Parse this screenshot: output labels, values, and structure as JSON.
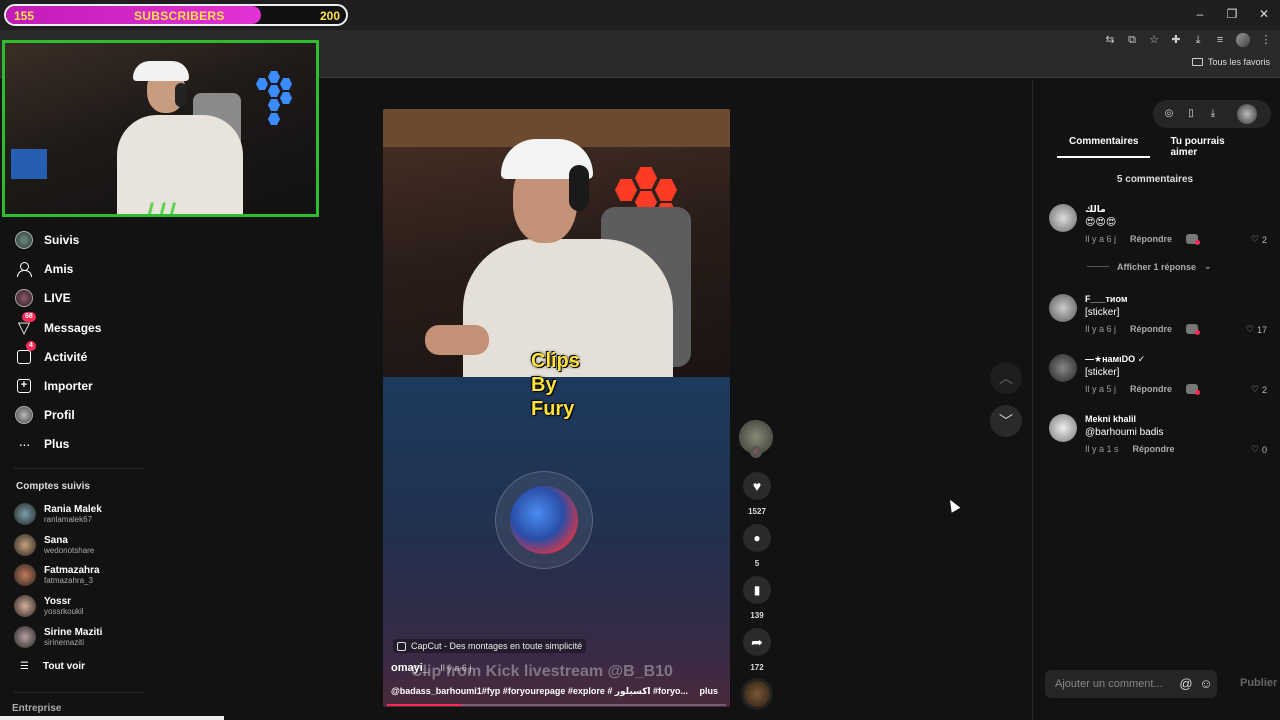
{
  "subscriber_bar": {
    "min": "155",
    "title": "SUBSCRIBERS",
    "max": "200",
    "progress_fraction": 0.75
  },
  "window": {
    "minimize": "–",
    "restore": "❐",
    "close": "✕"
  },
  "bookmarks": {
    "folder_label": "Tous les favoris"
  },
  "sidebar": {
    "nav": [
      {
        "label": "Suivis"
      },
      {
        "label": "Amis"
      },
      {
        "label": "LIVE"
      },
      {
        "label": "Messages",
        "badge": "68"
      },
      {
        "label": "Activité",
        "badge": "4"
      },
      {
        "label": "Importer"
      },
      {
        "label": "Profil"
      },
      {
        "label": "Plus"
      }
    ],
    "following_title": "Comptes suivis",
    "following": [
      {
        "name": "Rania Malek",
        "handle": "ranlamalek67",
        "color": "#7aa0a8"
      },
      {
        "name": "Sana",
        "handle": "wedonotshare",
        "color": "#c9a27a"
      },
      {
        "name": "Fatmazahra",
        "handle": "fatmazahra_3",
        "color": "#c47a5a"
      },
      {
        "name": "Yossr",
        "handle": "yossrkoukil",
        "color": "#d9b09a"
      },
      {
        "name": "Sirine Maziti",
        "handle": "sirinemaziti",
        "color": "#b8a0a0"
      }
    ],
    "see_all": "Tout voir",
    "footer": "Entreprise"
  },
  "video": {
    "caption_lines": [
      "Clips",
      "By",
      "Fury"
    ],
    "capcut": "CapCut - Des montages en toute simplicité",
    "watermark": "Clip from Kick livestream @B_B10",
    "author": "omayi_",
    "time": "· Il y a 6 j",
    "description": "@badass_barhoumi1#fyp #foryourepage #explore # اكسبلور #foryo...",
    "more": "plus",
    "progress_fraction": 0.22
  },
  "actions": {
    "likes": "1527",
    "comments": "5",
    "saves": "139",
    "shares": "172"
  },
  "panel": {
    "tabs": [
      "Commentaires",
      "Tu pourrais aimer"
    ],
    "count": "5 commentaires",
    "comments": [
      {
        "user": "مالك",
        "text": "😍😍😍",
        "time": "Il y a 6 j",
        "reply": "Répondre",
        "likes": "2"
      },
      {
        "user": "F___тиом",
        "text": "[sticker]",
        "time": "Il y a 6 j",
        "reply": "Répondre",
        "likes": "17"
      },
      {
        "user": "—★намıDO ✓",
        "text": "[sticker]",
        "time": "Il y a 5 j",
        "reply": "Répondre",
        "likes": "2"
      },
      {
        "user": "Mekni khalil",
        "text": "@barhoumi badis",
        "time": "Il y a 1 s",
        "reply": "Répondre",
        "likes": "0"
      }
    ],
    "view_replies": "Afficher 1 réponse",
    "input_placeholder": "Ajouter un comment...",
    "publish": "Publier"
  }
}
